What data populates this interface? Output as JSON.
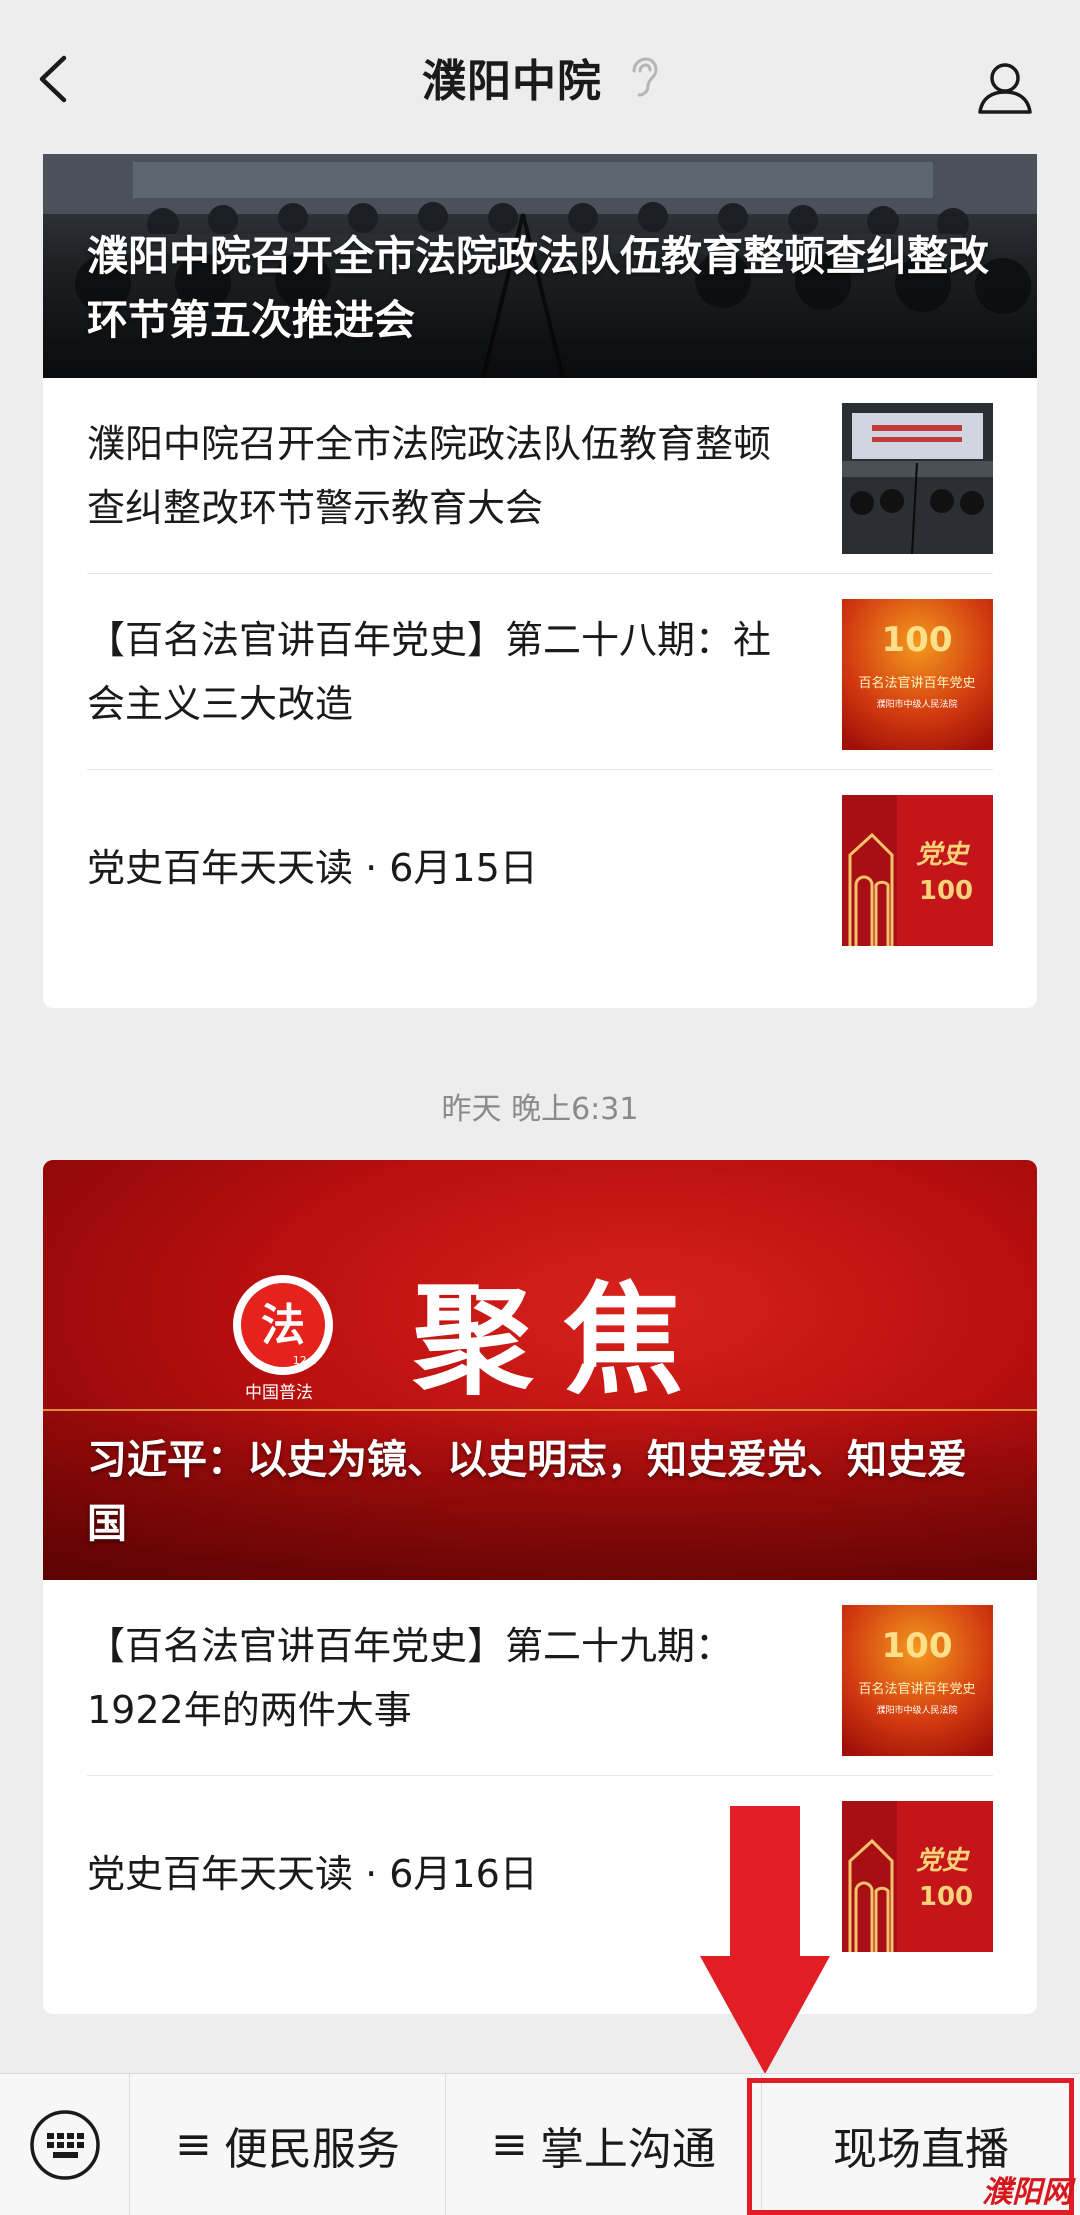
{
  "header": {
    "title": "濮阳中院"
  },
  "card1": {
    "cover_title": "濮阳中院召开全市法院政法队伍教育整顿查纠整改环节第五次推进会",
    "items": [
      {
        "title": "濮阳中院召开全市法院政法队伍教育整顿查纠整改环节警示教育大会"
      },
      {
        "title": "【百名法官讲百年党史】第二十八期：社会主义三大改造"
      },
      {
        "title": "党史百年天天读 · 6月15日"
      }
    ]
  },
  "time_label": "昨天 晚上6:31",
  "card2": {
    "cover_big_text": "聚焦",
    "logo_caption": "中国普法",
    "logo_char": "法",
    "logo_sub": "12·4",
    "cover_title": "习近平：以史为镜、以史明志，知史爱党、知史爱国",
    "items": [
      {
        "title": "【百名法官讲百年党史】第二十九期：1922年的两件大事"
      },
      {
        "title": "党史百年天天读 · 6月16日"
      }
    ]
  },
  "thumbs": {
    "course_banner": "百名法官讲百年党史",
    "court_name": "濮阳市中级人民法院",
    "dangshi_text": "党史",
    "hundred": "100"
  },
  "bottom_menu": {
    "item1": "便民服务",
    "item2": "掌上沟通",
    "item3": "现场直播",
    "prefix": "≡"
  },
  "watermark": "濮阳网",
  "colors": {
    "accent_red": "#e11d25",
    "background": "#ededed"
  }
}
